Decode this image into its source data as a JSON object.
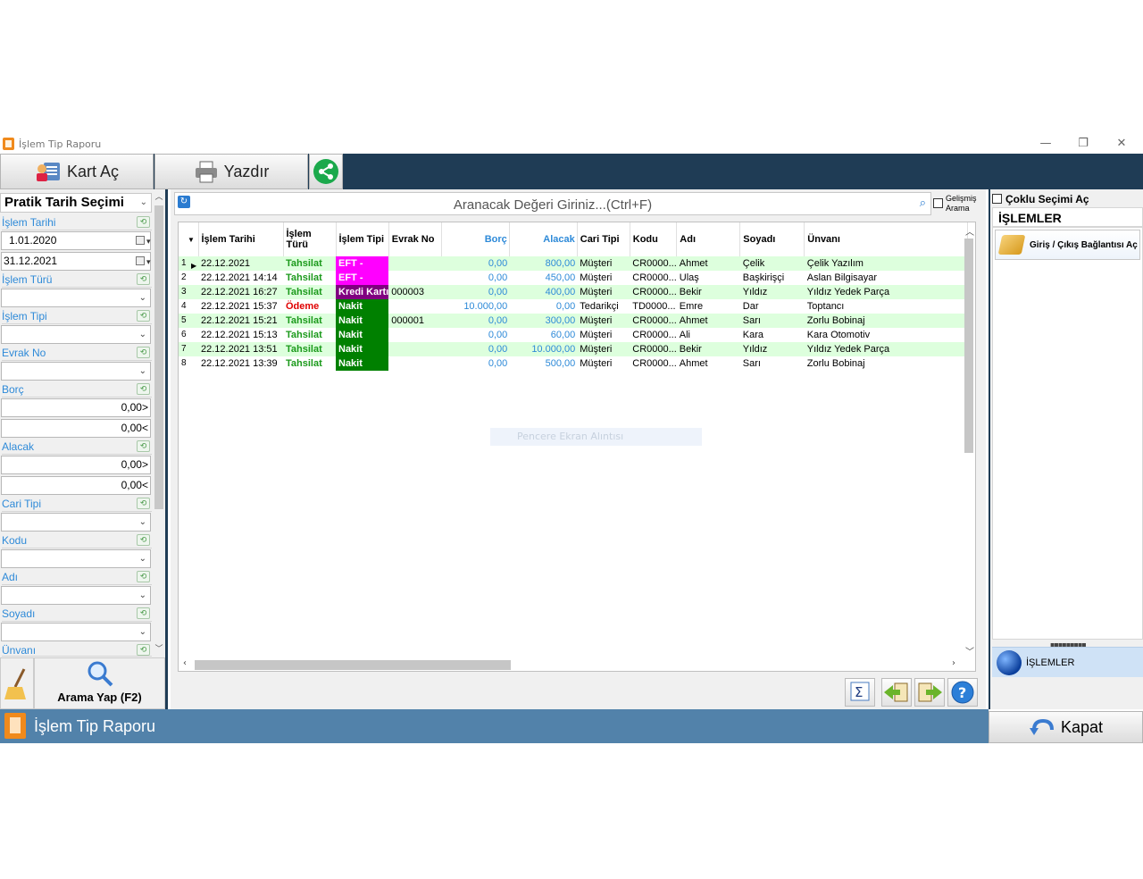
{
  "window": {
    "title": "İşlem Tip Raporu",
    "minimize": "—",
    "restore": "❐",
    "close": "✕"
  },
  "toolbar": {
    "open_card": "Kart Aç",
    "print": "Yazdır"
  },
  "left": {
    "header": "Pratik Tarih Seçimi",
    "filters": {
      "islem_tarihi": {
        "label": "İşlem Tarihi",
        "from": "1.01.2020",
        "to": "31.12.2021"
      },
      "islem_turu": {
        "label": "İşlem Türü"
      },
      "islem_tipi": {
        "label": "İşlem Tipi"
      },
      "evrak_no": {
        "label": "Evrak No"
      },
      "borc": {
        "label": "Borç",
        "min": "0,00>",
        "max": "0,00<"
      },
      "alacak": {
        "label": "Alacak",
        "min": "0,00>",
        "max": "0,00<"
      },
      "cari_tipi": {
        "label": "Cari Tipi"
      },
      "kodu": {
        "label": "Kodu"
      },
      "adi": {
        "label": "Adı"
      },
      "soyadi": {
        "label": "Soyadı"
      },
      "unvani": {
        "label": "Ünvanı"
      }
    },
    "search_button": "Arama Yap (F2)"
  },
  "main": {
    "search_placeholder": "Aranacak Değeri Giriniz...(Ctrl+F)",
    "advanced_search": "Gelişmiş Arama",
    "ghost_text": "Pencere Ekran Alıntısı",
    "columns": [
      "İşlem Tarihi",
      "İşlem Türü",
      "İşlem Tipi",
      "Evrak No",
      "Borç",
      "Alacak",
      "Cari Tipi",
      "Kodu",
      "Adı",
      "Soyadı",
      "Ünvanı"
    ],
    "rows": [
      {
        "n": "1",
        "tarih": "22.12.2021",
        "tur": "Tahsilat",
        "tip": "EFT -",
        "tip_color": "#ff00ff",
        "evrak": "",
        "borc": "0,00",
        "alacak": "800,00",
        "cari": "Müşteri",
        "kodu": "CR0000...",
        "adi": "Ahmet",
        "soyadi": "Çelik",
        "unvani": "Çelik Yazılım"
      },
      {
        "n": "2",
        "tarih": "22.12.2021 14:14",
        "tur": "Tahsilat",
        "tip": "EFT -",
        "tip_color": "#ff00ff",
        "evrak": "",
        "borc": "0,00",
        "alacak": "450,00",
        "cari": "Müşteri",
        "kodu": "CR0000...",
        "adi": "Ulaş",
        "soyadi": "Başkirişçi",
        "unvani": "Aslan Bilgisayar"
      },
      {
        "n": "3",
        "tarih": "22.12.2021 16:27",
        "tur": "Tahsilat",
        "tip": "Kredi Kartı",
        "tip_color": "#800080",
        "evrak": "000003",
        "borc": "0,00",
        "alacak": "400,00",
        "cari": "Müşteri",
        "kodu": "CR0000...",
        "adi": "Bekir",
        "soyadi": "Yıldız",
        "unvani": "Yıldız Yedek Parça"
      },
      {
        "n": "4",
        "tarih": "22.12.2021 15:37",
        "tur": "Ödeme",
        "tip": "Nakit",
        "tip_color": "#008000",
        "evrak": "",
        "borc": "10.000,00",
        "alacak": "0,00",
        "cari": "Tedarikçi",
        "kodu": "TD0000...",
        "adi": "Emre",
        "soyadi": "Dar",
        "unvani": "Toptancı"
      },
      {
        "n": "5",
        "tarih": "22.12.2021 15:21",
        "tur": "Tahsilat",
        "tip": "Nakit",
        "tip_color": "#008000",
        "evrak": "000001",
        "borc": "0,00",
        "alacak": "300,00",
        "cari": "Müşteri",
        "kodu": "CR0000...",
        "adi": "Ahmet",
        "soyadi": "Sarı",
        "unvani": "Zorlu Bobinaj"
      },
      {
        "n": "6",
        "tarih": "22.12.2021 15:13",
        "tur": "Tahsilat",
        "tip": "Nakit",
        "tip_color": "#008000",
        "evrak": "",
        "borc": "0,00",
        "alacak": "60,00",
        "cari": "Müşteri",
        "kodu": "CR0000...",
        "adi": "Ali",
        "soyadi": "Kara",
        "unvani": "Kara Otomotiv"
      },
      {
        "n": "7",
        "tarih": "22.12.2021 13:51",
        "tur": "Tahsilat",
        "tip": "Nakit",
        "tip_color": "#008000",
        "evrak": "",
        "borc": "0,00",
        "alacak": "10.000,00",
        "cari": "Müşteri",
        "kodu": "CR0000...",
        "adi": "Bekir",
        "soyadi": "Yıldız",
        "unvani": "Yıldız Yedek Parça"
      },
      {
        "n": "8",
        "tarih": "22.12.2021 13:39",
        "tur": "Tahsilat",
        "tip": "Nakit",
        "tip_color": "#008000",
        "evrak": "",
        "borc": "0,00",
        "alacak": "500,00",
        "cari": "Müşteri",
        "kodu": "CR0000...",
        "adi": "Ahmet",
        "soyadi": "Sarı",
        "unvani": "Zorlu Bobinaj"
      }
    ]
  },
  "right": {
    "multi_select": "Çoklu Seçimi Aç",
    "title": "İŞLEMLER",
    "item": "Giriş / Çıkış Bağlantısı Aç",
    "group": "İŞLEMLER"
  },
  "status": {
    "title": "İşlem Tip Raporu"
  },
  "close_button": "Kapat"
}
